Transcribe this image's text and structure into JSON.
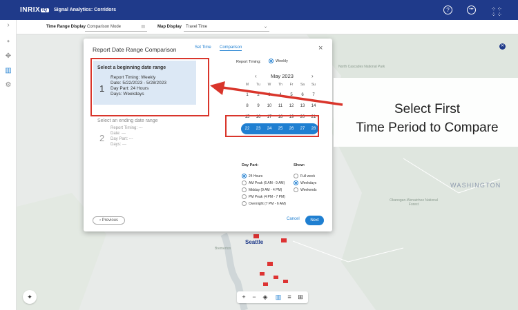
{
  "header": {
    "logo": "INRIX",
    "logo_badge": "IQ",
    "app_title": "Signal Analytics: Corridors",
    "icons": [
      "help-icon",
      "account-icon",
      "apps-grid-icon"
    ]
  },
  "filters": {
    "time_range_label": "Time Range Display",
    "time_range_value": "Comparison Mode",
    "map_display_label": "Map Display",
    "map_display_value": "Travel Time"
  },
  "map": {
    "labels": [
      "North Cascades National Park",
      "WASHINGTON",
      "Okanogan-Wenatchee National Forest",
      "Seattle",
      "Bremerton"
    ]
  },
  "modal": {
    "title": "Report Date Range Comparison",
    "tabs": [
      "Set Time",
      "Comparison"
    ],
    "close": "×",
    "step1": {
      "number": "1",
      "heading": "Select a beginning date range",
      "lines": [
        "Report Timing:  Weekly",
        "Date:  5/22/2023 - 5/28/2023",
        "Day Part:  24 Hours",
        "Days:  Weekdays"
      ]
    },
    "step2": {
      "number": "2",
      "heading": "Select an ending date range",
      "lines": [
        "Report Timing:   ---",
        "Date:   ---",
        "Day Part:   ---",
        "Days:   ---"
      ]
    },
    "previous_button": "‹  Previous",
    "cancel_button": "Cancel",
    "next_button": "Next",
    "report_timing_label": "Report Timing:",
    "report_timing_value": "Weekly",
    "calendar": {
      "month": "May 2023",
      "prev": "‹",
      "next": "›",
      "weekdays": [
        "M",
        "Tu",
        "W",
        "Th",
        "Fr",
        "Sa",
        "Su"
      ],
      "rows": [
        [
          "1",
          "2",
          "3",
          "4",
          "5",
          "6",
          "7"
        ],
        [
          "8",
          "9",
          "10",
          "11",
          "12",
          "13",
          "14"
        ],
        [
          "15",
          "16",
          "17",
          "18",
          "19",
          "20",
          "21"
        ]
      ],
      "selected_week": [
        "22",
        "23",
        "24",
        "25",
        "26",
        "27",
        "28"
      ]
    },
    "day_part": {
      "title": "Day Part:",
      "options": [
        "24 Hours",
        "AM Peak (6 AM - 9 AM)",
        "Midday (9 AM - 4 PM)",
        "PM Peak (4 PM - 7 PM)",
        "Overnight (7 PM - 6 AM)"
      ],
      "selected": "24 Hours"
    },
    "show": {
      "title": "Show:",
      "options": [
        "Full week",
        "Weekdays",
        "Weekends"
      ],
      "selected": "Weekdays"
    }
  },
  "callout": {
    "line1": "Select First",
    "line2": "Time Period to Compare"
  },
  "colors": {
    "brand": "#1f3a8a",
    "accent": "#1f7fd1",
    "highlight": "#d9352b"
  }
}
